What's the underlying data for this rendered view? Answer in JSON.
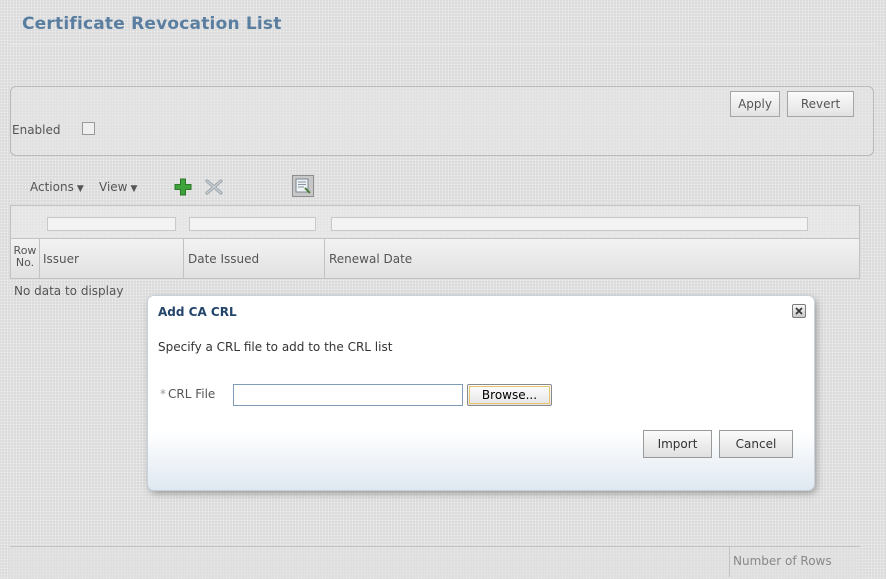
{
  "page": {
    "title": "Certificate Revocation List"
  },
  "section": {
    "apply_label": "Apply",
    "revert_label": "Revert",
    "enabled_label": "Enabled",
    "enabled_checked": false
  },
  "toolbar": {
    "actions_label": "Actions",
    "view_label": "View",
    "icons": [
      "add-icon",
      "delete-icon",
      "detach-icon"
    ]
  },
  "table": {
    "row_no_label": "Row No.",
    "columns": [
      "Issuer",
      "Date Issued",
      "Renewal Date"
    ],
    "empty_message": "No data to display",
    "footer_label": "Number of Rows"
  },
  "dialog": {
    "title": "Add CA CRL",
    "instructions": "Specify a CRL file to add to the CRL list",
    "required_marker": "*",
    "crl_file_label": "CRL File",
    "crl_file_value": "",
    "browse_label": "Browse...",
    "import_label": "Import",
    "cancel_label": "Cancel"
  }
}
